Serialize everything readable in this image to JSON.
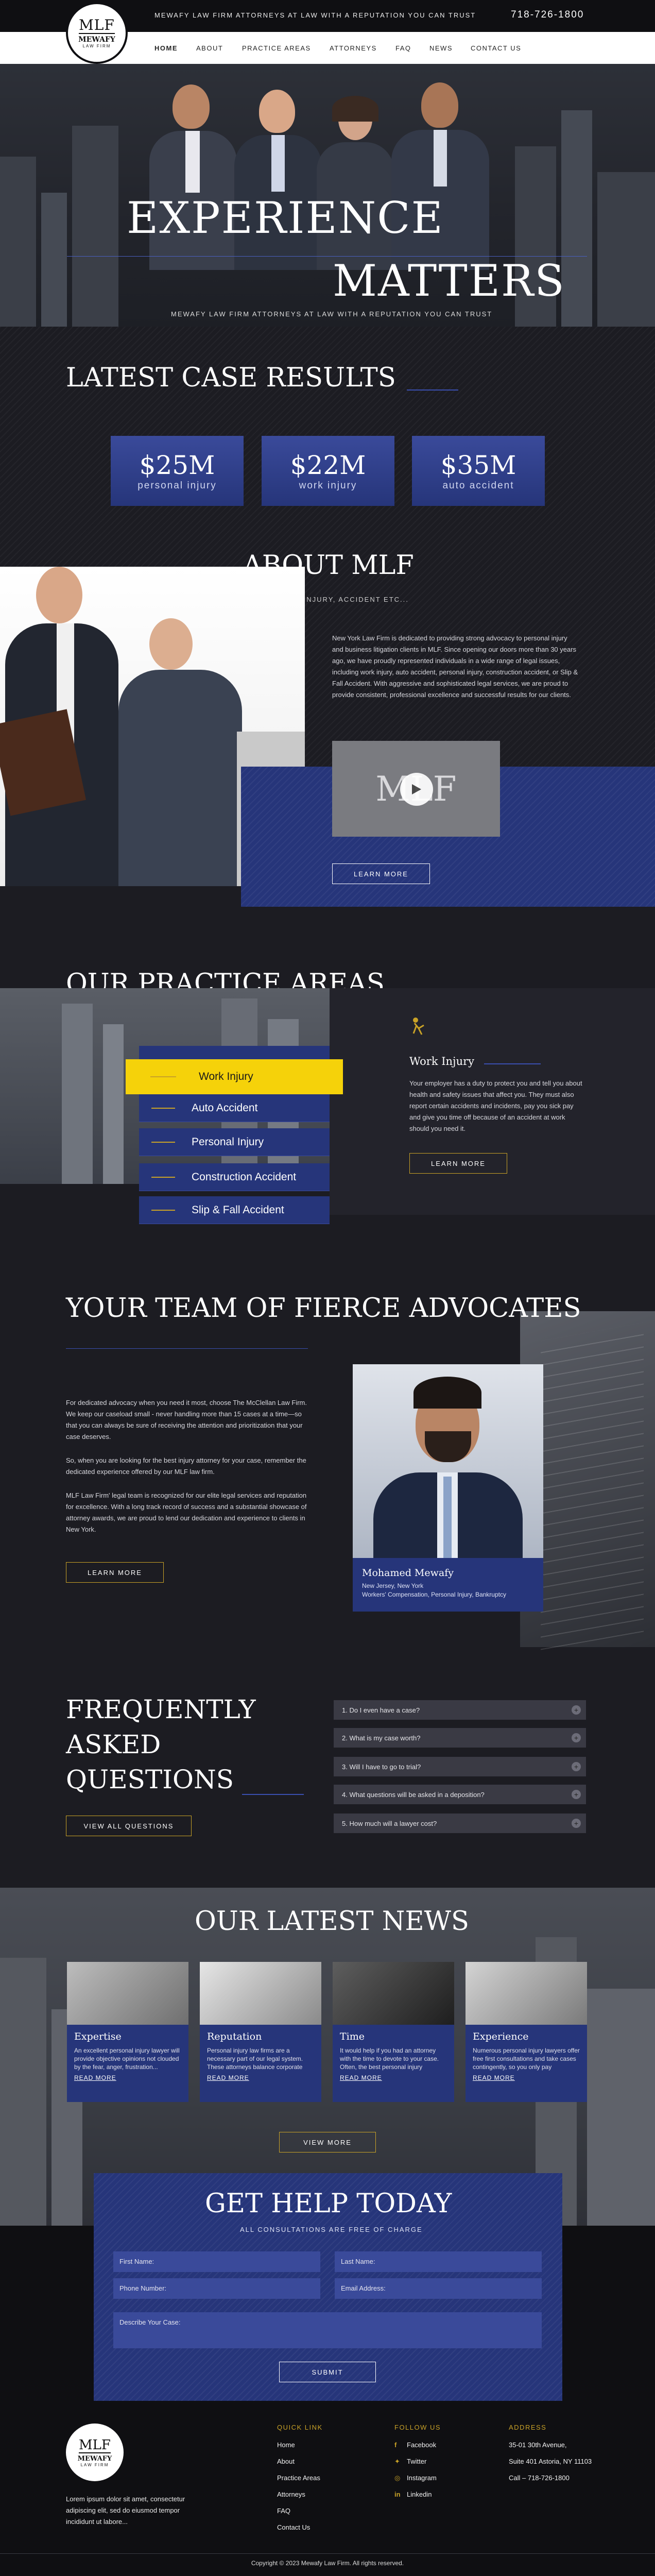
{
  "header": {
    "tagline": "MEWAFY LAW FIRM ATTORNEYS AT LAW WITH A REPUTATION YOU CAN TRUST",
    "phone": "718-726-1800",
    "logo_name": "MEWAFY",
    "logo_sub": "LAW FIRM",
    "logo_mark": "MLF",
    "nav": [
      "HOME",
      "ABOUT",
      "PRACTICE AREAS",
      "ATTORNEYS",
      "FAQ",
      "NEWS",
      "CONTACT US"
    ]
  },
  "hero": {
    "line1": "EXPERIENCE",
    "line2": "MATTERS",
    "sub": "MEWAFY LAW FIRM ATTORNEYS AT LAW WITH A REPUTATION YOU CAN TRUST"
  },
  "results": {
    "title": "LATEST CASE RESULTS",
    "items": [
      {
        "amount": "$25M",
        "label": "personal injury"
      },
      {
        "amount": "$22M",
        "label": "work injury"
      },
      {
        "amount": "$35M",
        "label": "auto accident"
      }
    ]
  },
  "about": {
    "title": "ABOUT MLF",
    "sub": "SUFFERED INJURY, ACCIDENT ETC...",
    "text": "New York Law Firm is dedicated to providing strong advocacy to personal injury and business litigation clients in MLF. Since opening our doors more than 30 years ago, we have proudly represented individuals in a wide range of legal issues, including work injury, auto accident, personal injury, construction accident, or Slip & Fall Accident. With aggressive and sophisticated legal services, we are proud to provide consistent, professional excellence and successful results for our clients.",
    "video_logo": "MLF",
    "button": "LEARN MORE"
  },
  "practice": {
    "title": "OUR PRACTICE AREAS",
    "items": [
      "Work Injury",
      "Auto Accident",
      "Personal Injury",
      "Construction Accident",
      "Slip & Fall Accident"
    ],
    "detail_title": "Work Injury",
    "detail_text": "Your employer has a duty to protect you and tell you about health and safety issues that affect you. They must also report certain accidents and incidents, pay you sick pay and give you time off because of an accident at work should you need it.",
    "button": "LEARN MORE"
  },
  "team": {
    "title": "YOUR TEAM OF FIERCE ADVOCATES",
    "p1": "For dedicated advocacy when you need it most, choose The McClellan Law Firm. We keep our caseload small - never handling more than 15 cases at a time—so that you can always be sure of receiving the attention and prioritization that your case deserves.",
    "p2": "So, when you are looking for the best injury attorney for your case, remember the dedicated experience offered by our MLF law firm.",
    "p3": "MLF Law Firm' legal team is recognized for our elite legal services and reputation for excellence. With a long track record of success and a substantial showcase of attorney awards, we are proud to lend our dedication and experience to clients in New York.",
    "button": "LEARN MORE",
    "attorney_name": "Mohamed Mewafy",
    "attorney_location": "New Jersey, New York",
    "attorney_areas": "Workers' Compensation, Personal Injury, Bankruptcy"
  },
  "faq": {
    "title1": "FREQUENTLY",
    "title2": "ASKED",
    "title3": "QUESTIONS",
    "button": "VIEW ALL QUESTIONS",
    "items": [
      "1. Do I even have a case?",
      "2. What is my case worth?",
      "3. Will I have to go to trial?",
      "4. What questions will be asked in a deposition?",
      "5. How much will a lawyer cost?"
    ]
  },
  "news": {
    "title": "OUR LATEST NEWS",
    "items": [
      {
        "title": "Expertise",
        "text": "An excellent personal injury lawyer will provide objective opinions not clouded by the fear, anger, frustration...",
        "more": "READ MORE"
      },
      {
        "title": "Reputation",
        "text": "Personal injury law firms are a necessary part of our legal system. These attorneys balance corporate",
        "more": "READ MORE"
      },
      {
        "title": "Time",
        "text": "It would help if you had an attorney with the time to devote to your case. Often, the best personal injury",
        "more": "READ MORE"
      },
      {
        "title": "Experience",
        "text": "Numerous personal injury lawyers offer free first consultations and take cases contingently, so you only pay",
        "more": "READ MORE"
      }
    ],
    "button": "VIEW MORE"
  },
  "contact": {
    "title": "GET HELP TODAY",
    "sub": "ALL CONSULTATIONS ARE FREE OF CHARGE",
    "first_name": "First Name:",
    "last_name": "Last Name:",
    "phone": "Phone Number:",
    "email": "Email Address:",
    "describe": "Describe Your Case:",
    "submit": "SUBMIT"
  },
  "footer": {
    "about_text": "Lorem ipsum dolor sit amet, consectetur adipiscing elit, sed do eiusmod tempor incididunt ut labore...",
    "quick_title": "QUICK LINK",
    "quick_links": [
      "Home",
      "About",
      "Practice Areas",
      "Attorneys",
      "FAQ",
      "Contact Us"
    ],
    "follow_title": "FOLLOW US",
    "social": [
      "Facebook",
      "Twitter",
      "Instagram",
      "Linkedin"
    ],
    "address_title": "ADDRESS",
    "address": [
      "35-01 30th Avenue,",
      "Suite 401 Astoria, NY 11103",
      "Call – 718-726-1800"
    ],
    "copyright": "Copyright © 2023 Mewafy Law Firm. All rights reserved."
  },
  "colors": {
    "gold": "#c9a227",
    "navy": "#26357a",
    "dark": "#1c1c22",
    "yellow": "#f5d20a"
  }
}
